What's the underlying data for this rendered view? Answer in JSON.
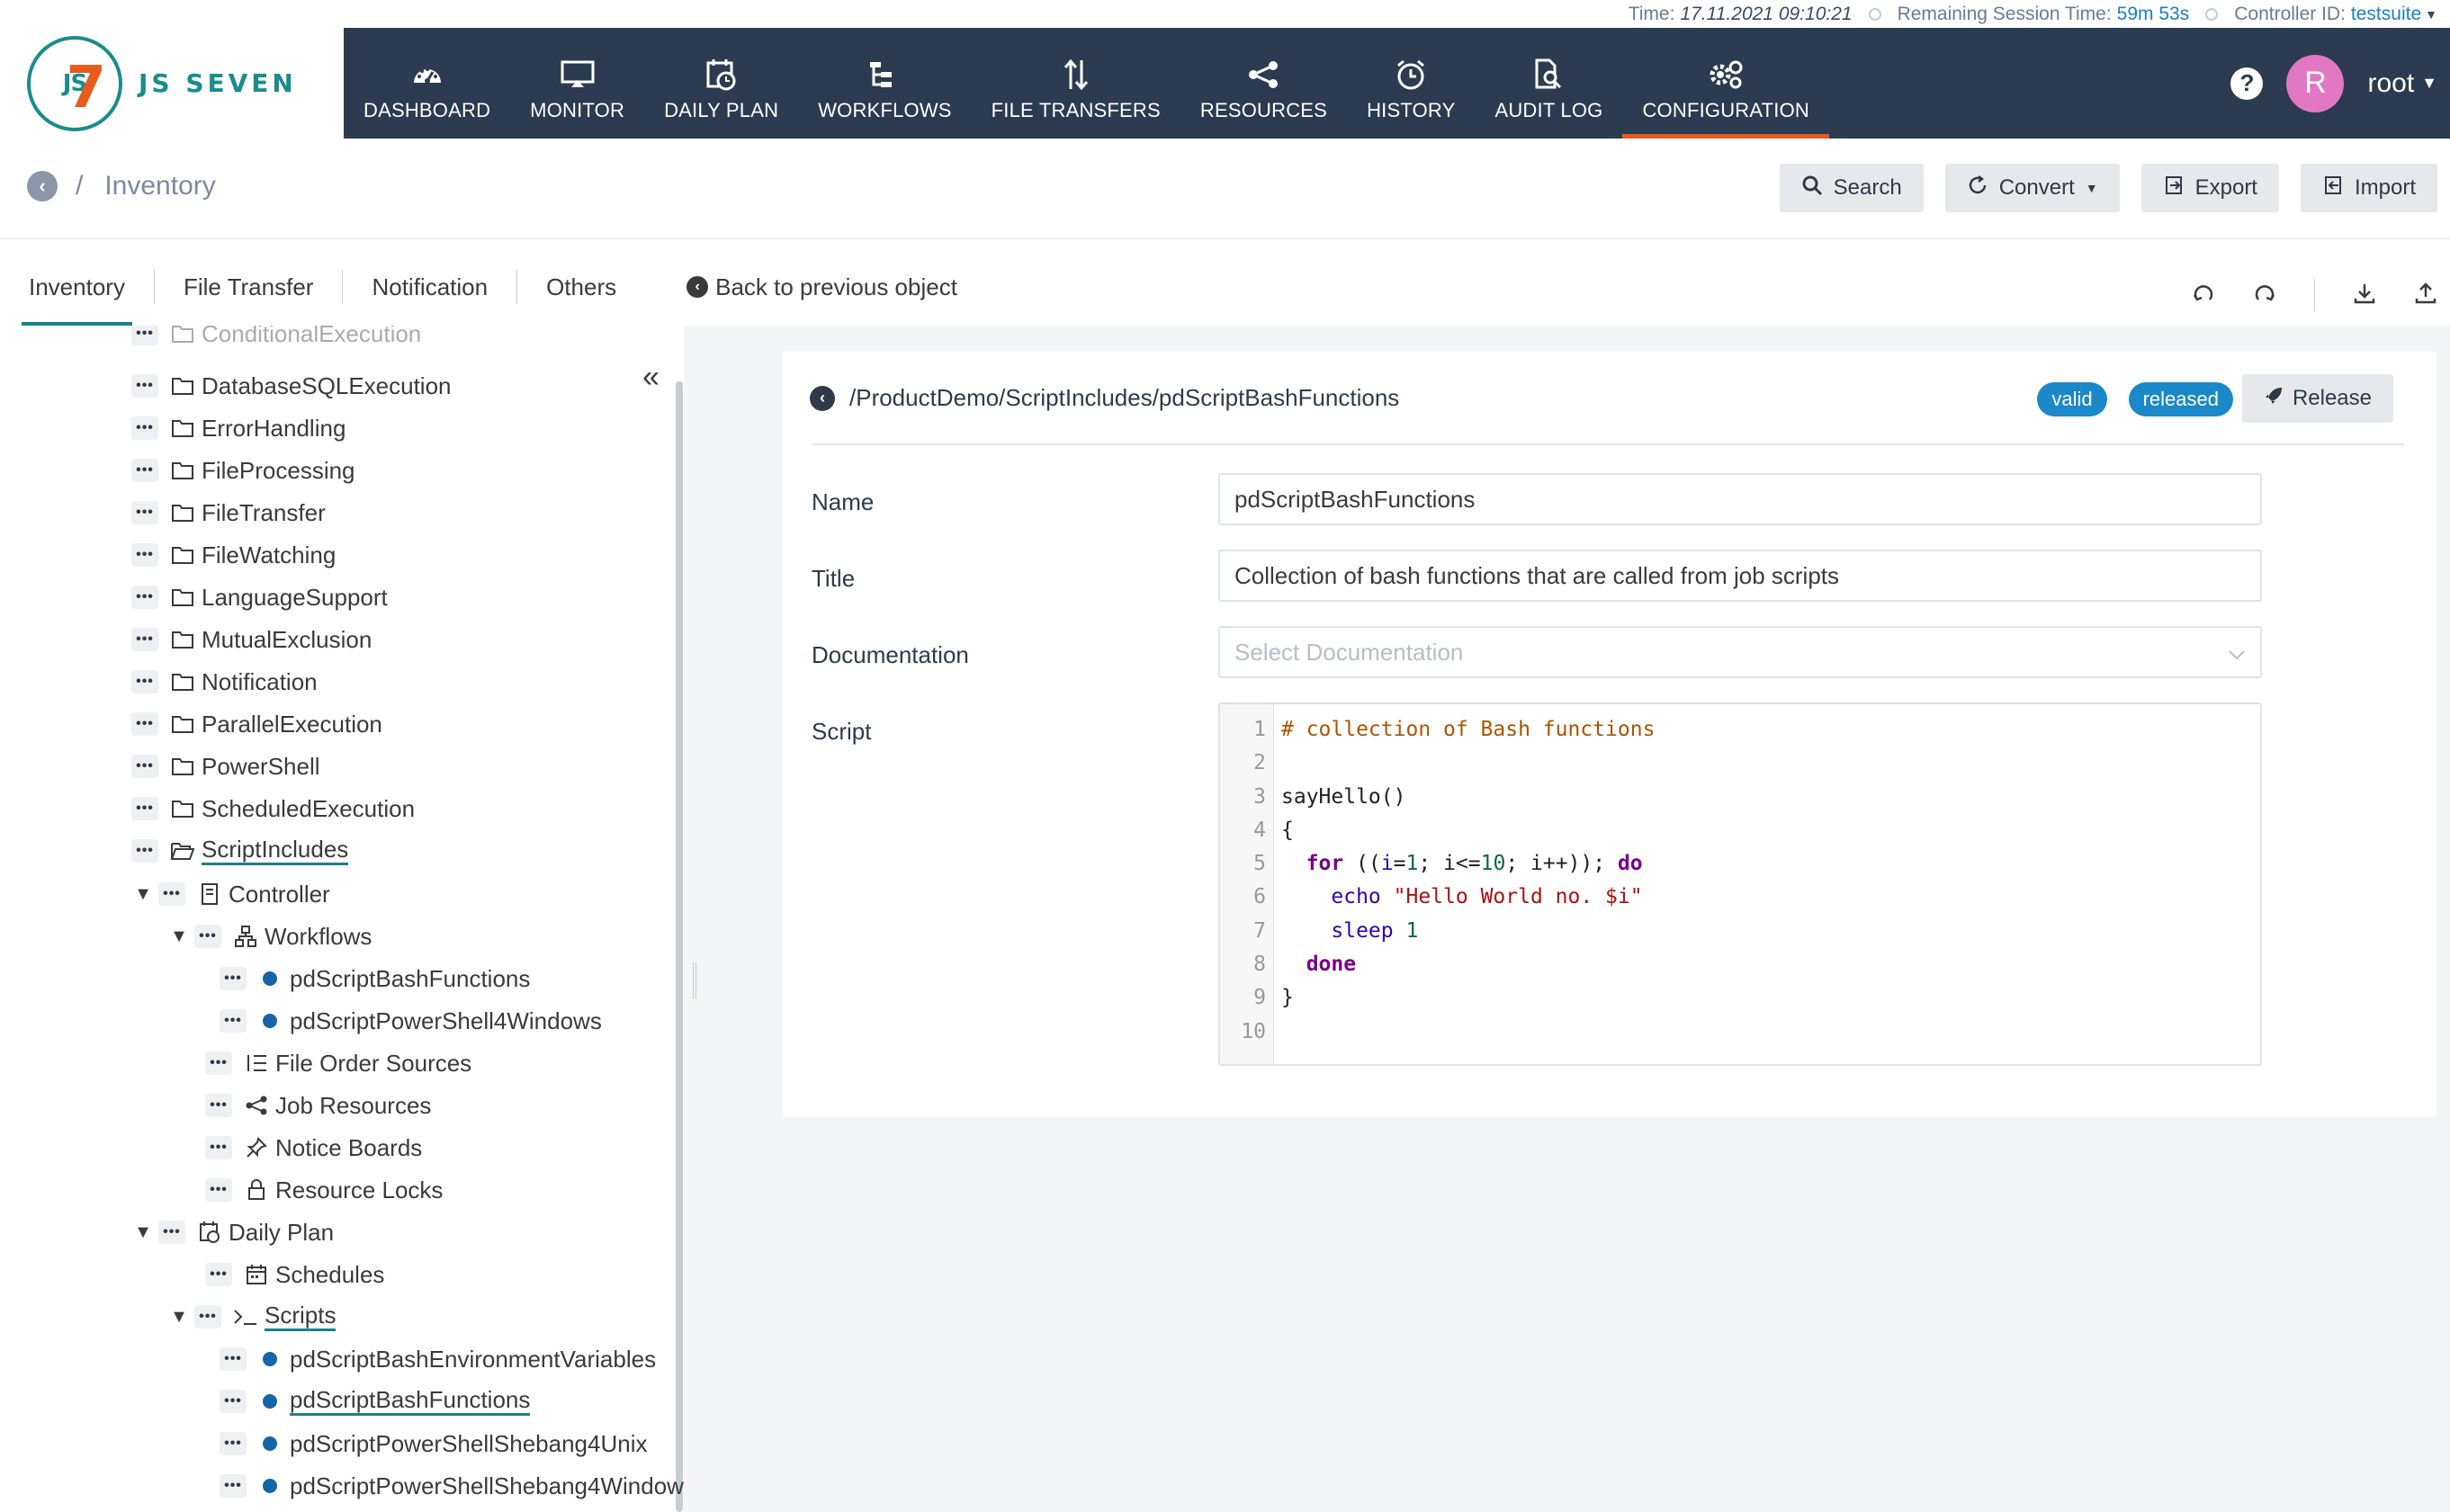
{
  "status": {
    "time_label": "Time:",
    "time_value": "17.11.2021 09:10:21",
    "session_label": "Remaining Session Time:",
    "session_value": "59m 53s",
    "controller_label": "Controller ID:",
    "controller_value": "testsuite"
  },
  "logo": {
    "text": "JS SEVEN",
    "mark": "JS"
  },
  "nav": [
    {
      "label": "DASHBOARD",
      "icon": "dashboard-icon"
    },
    {
      "label": "MONITOR",
      "icon": "monitor-icon"
    },
    {
      "label": "DAILY PLAN",
      "icon": "daily-plan-icon"
    },
    {
      "label": "WORKFLOWS",
      "icon": "workflows-icon"
    },
    {
      "label": "FILE TRANSFERS",
      "icon": "file-transfers-icon"
    },
    {
      "label": "RESOURCES",
      "icon": "resources-icon"
    },
    {
      "label": "HISTORY",
      "icon": "history-icon"
    },
    {
      "label": "AUDIT LOG",
      "icon": "audit-log-icon"
    },
    {
      "label": "CONFIGURATION",
      "icon": "configuration-icon",
      "active": true
    }
  ],
  "user": {
    "avatar_letter": "R",
    "name": "root"
  },
  "breadcrumb": {
    "current": "Inventory"
  },
  "toolbar": {
    "search": "Search",
    "convert": "Convert",
    "export": "Export",
    "import": "Import"
  },
  "tabs": {
    "items": [
      "Inventory",
      "File Transfer",
      "Notification",
      "Others"
    ],
    "back_previous": "Back to previous object"
  },
  "tree": {
    "cut_top": "ConditionalExecution",
    "folders": [
      "DatabaseSQLExecution",
      "ErrorHandling",
      "FileProcessing",
      "FileTransfer",
      "FileWatching",
      "LanguageSupport",
      "MutualExclusion",
      "Notification",
      "ParallelExecution",
      "PowerShell",
      "ScheduledExecution",
      "ScriptIncludes"
    ],
    "controller": "Controller",
    "workflows": "Workflows",
    "workflow_items": [
      "pdScriptBashFunctions",
      "pdScriptPowerShell4Windows"
    ],
    "file_order_sources": "File Order Sources",
    "job_resources": "Job Resources",
    "notice_boards": "Notice Boards",
    "resource_locks": "Resource Locks",
    "daily_plan": "Daily Plan",
    "schedules": "Schedules",
    "scripts": "Scripts",
    "script_items": [
      "pdScriptBashEnvironmentVariables",
      "pdScriptBashFunctions",
      "pdScriptPowerShellShebang4Unix",
      "pdScriptPowerShellShebang4Window"
    ]
  },
  "detail": {
    "path": "/ProductDemo/ScriptIncludes/pdScriptBashFunctions",
    "badge_valid": "valid",
    "badge_released": "released",
    "release_button": "Release",
    "name_label": "Name",
    "name_value": "pdScriptBashFunctions",
    "title_label": "Title",
    "title_value": "Collection of bash functions that are called from job scripts",
    "doc_label": "Documentation",
    "doc_placeholder": "Select Documentation",
    "script_label": "Script",
    "line_numbers": [
      "1",
      "2",
      "3",
      "4",
      "5",
      "6",
      "7",
      "8",
      "9",
      "10"
    ],
    "code": {
      "l1": "# collection of Bash functions",
      "l3": "sayHello()",
      "l4": "{",
      "l5_for": "for",
      "l5_a": " ((",
      "l5_i": "i",
      "l5_b": "=",
      "l5_1": "1",
      "l5_c": "; i<=",
      "l5_10": "10",
      "l5_d": "; i++)); ",
      "l5_do": "do",
      "l6_echo": "echo",
      "l6_str": "\"Hello World no. $i\"",
      "l7_sleep": "sleep",
      "l7_num": "1",
      "l8": "done",
      "l9": "}"
    }
  },
  "colors": {
    "header_bg": "#2c3b4f",
    "accent": "#e85a1c",
    "teal": "#1a7f8c",
    "badge": "#1a88c9"
  }
}
